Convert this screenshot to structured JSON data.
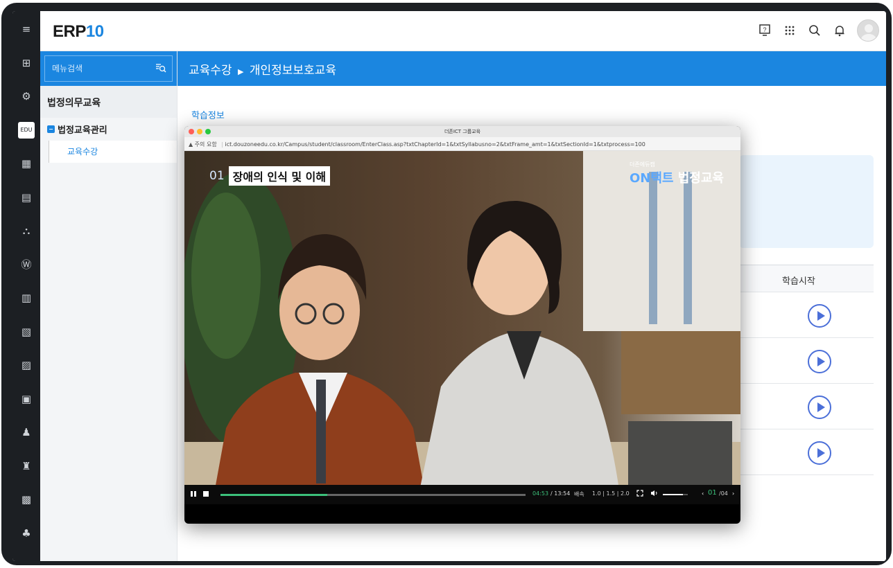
{
  "app": {
    "logo_main": "ERP",
    "logo_accent": "10"
  },
  "iconbar": {
    "items": [
      {
        "name": "menu-toggle-icon",
        "glyph": "≡"
      },
      {
        "name": "org-icon",
        "glyph": "⊞"
      },
      {
        "name": "settings-gear-icon",
        "glyph": "⚙"
      },
      {
        "name": "edu-icon",
        "glyph": "EDU"
      },
      {
        "name": "calculator-icon",
        "glyph": "▦"
      },
      {
        "name": "document-settings-icon",
        "glyph": "▤"
      },
      {
        "name": "workflow-icon",
        "glyph": "⛬"
      },
      {
        "name": "money-bag-icon",
        "glyph": "Ⓦ"
      },
      {
        "name": "building-icon",
        "glyph": "▥"
      },
      {
        "name": "buildings-icon",
        "glyph": "▧"
      },
      {
        "name": "report-icon",
        "glyph": "▨"
      },
      {
        "name": "ledger-icon",
        "glyph": "▣"
      },
      {
        "name": "person-icon",
        "glyph": "♟"
      },
      {
        "name": "factory-icon",
        "glyph": "♜"
      },
      {
        "name": "box-icon",
        "glyph": "▩"
      },
      {
        "name": "network-icon",
        "glyph": "♣"
      }
    ]
  },
  "sidebar": {
    "search_placeholder": "메뉴검색",
    "heading": "법정의무교육",
    "group": "법정교육관리",
    "item": "교육수강"
  },
  "breadcrumb": {
    "parent": "교육수강",
    "separator": "▶",
    "current": "개인정보보호교육"
  },
  "main": {
    "section_title": "학습정보",
    "column_header": "학습시작",
    "rows": 4
  },
  "popup": {
    "window_title": "더존ICT 그룹교육",
    "security_warning": "▲ 주의 요함",
    "url": "ict.douzoneedu.co.kr/Campus/student/classroom/EnterClass.asp?txtChapterId=1&txtSyllabusno=2&txtFrame_amt=1&txtSectionId=1&txtprocess=100",
    "caption_number": "01",
    "caption_text": "장애의 인식 및 이해",
    "brand_small": "더존에듀캠",
    "brand_on": "ON",
    "brand_mid": "택트",
    "brand_main": "법정교육",
    "player": {
      "current_time": "04:53",
      "total_time": "/ 13:54",
      "speed_label": "배속",
      "speeds": "1.0 | 1.5 | 2.0",
      "page_current": "01",
      "page_total": "/04",
      "progress": 0.35,
      "volume": 0.8
    }
  }
}
